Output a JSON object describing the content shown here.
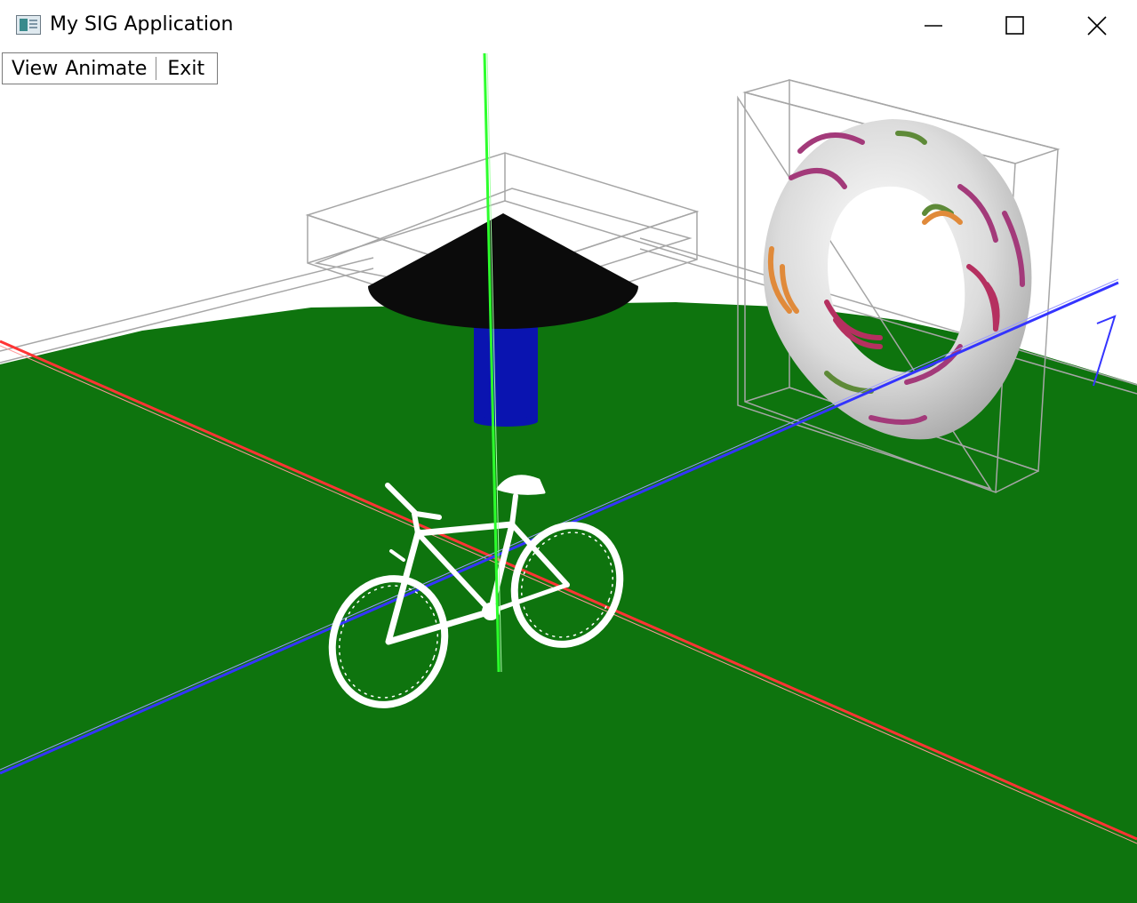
{
  "window": {
    "title": "My SIG Application",
    "icon": "app-window-icon",
    "controls": [
      "minimize-icon",
      "maximize-icon",
      "close-icon"
    ]
  },
  "menu": {
    "view_label": "View",
    "animate_label": "Animate",
    "exit_label": "Exit"
  },
  "scene": {
    "background": "#ffffff",
    "ground_color": "#0e740e",
    "axis_x_color": "#ff3b3b",
    "axis_y_color": "#41ff41",
    "axis_z_color": "#3b3bff",
    "bounding_box_color": "#a6a6a6",
    "objects": [
      "ground-disk",
      "black-cone-lamp",
      "blue-cylinder",
      "textured-torus",
      "white-bicycle",
      "coordinate-axes"
    ]
  }
}
